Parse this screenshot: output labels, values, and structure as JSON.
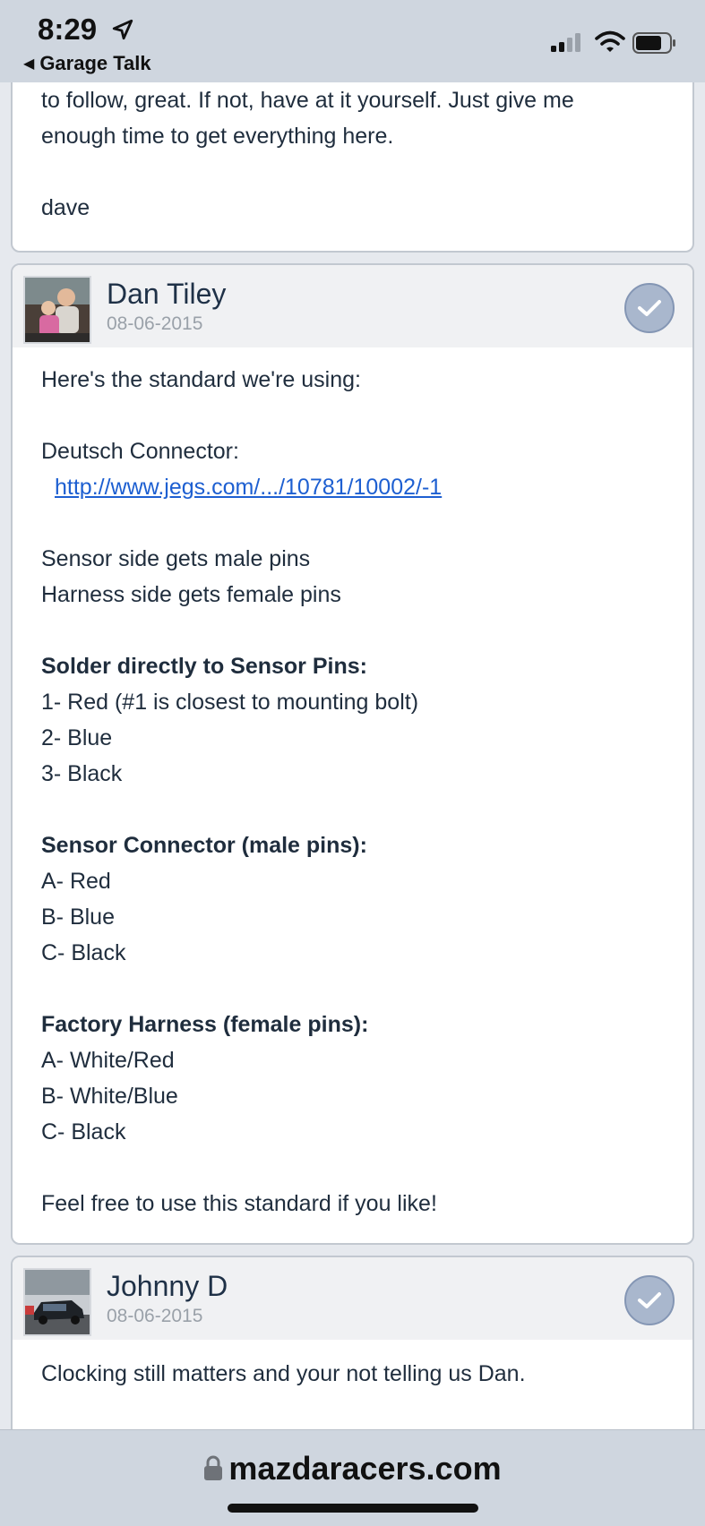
{
  "status_bar": {
    "time": "8:29",
    "back_label": "Garage Talk"
  },
  "browser": {
    "url": "mazdaracers.com"
  },
  "posts": [
    {
      "lines": [
        {
          "text": "to follow, great. If not, have at it yourself. Just give me",
          "style": "normal"
        },
        {
          "text": "enough time to get everything here.",
          "style": "normal"
        },
        {
          "text": "",
          "style": "blank"
        },
        {
          "text": "dave",
          "style": "normal"
        }
      ]
    },
    {
      "author": "Dan Tiley",
      "date": "08-06-2015",
      "lines": [
        {
          "text": "Here's the standard we're using:",
          "style": "normal"
        },
        {
          "text": "",
          "style": "blank"
        },
        {
          "text": "Deutsch Connector:",
          "style": "normal"
        },
        {
          "text": "http://www.jegs.com/.../10781/10002/-1",
          "style": "link"
        },
        {
          "text": "",
          "style": "blank"
        },
        {
          "text": "Sensor side gets male pins",
          "style": "normal"
        },
        {
          "text": "Harness side gets female pins",
          "style": "normal"
        },
        {
          "text": "",
          "style": "blank"
        },
        {
          "text": "Solder directly to Sensor Pins:",
          "style": "bold"
        },
        {
          "text": "1- Red (#1 is closest to mounting bolt)",
          "style": "normal"
        },
        {
          "text": "2- Blue",
          "style": "normal"
        },
        {
          "text": "3- Black",
          "style": "normal"
        },
        {
          "text": "",
          "style": "blank"
        },
        {
          "text": "Sensor Connector (male pins):",
          "style": "bold"
        },
        {
          "text": "A- Red",
          "style": "normal"
        },
        {
          "text": "B- Blue",
          "style": "normal"
        },
        {
          "text": "C- Black",
          "style": "normal"
        },
        {
          "text": "",
          "style": "blank"
        },
        {
          "text": "Factory Harness (female pins):",
          "style": "bold"
        },
        {
          "text": "A- White/Red",
          "style": "normal"
        },
        {
          "text": "B- White/Blue",
          "style": "normal"
        },
        {
          "text": "C- Black",
          "style": "normal"
        },
        {
          "text": "",
          "style": "blank"
        },
        {
          "text": "Feel free to use this standard if you like!",
          "style": "normal"
        }
      ]
    },
    {
      "author": "Johnny D",
      "date": "08-06-2015",
      "lines": [
        {
          "text": "Clocking still matters and your not telling us Dan.",
          "style": "normal"
        }
      ]
    }
  ]
}
